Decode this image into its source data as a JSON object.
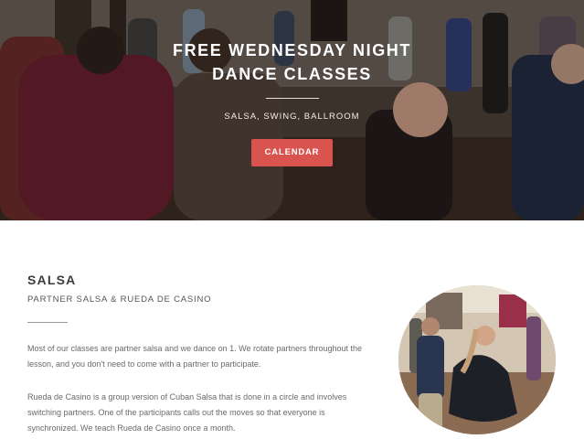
{
  "hero": {
    "title": "FREE WEDNESDAY NIGHT\nDANCE CLASSES",
    "subtitle": "SALSA, SWING, BALLROOM",
    "button_label": "CALENDAR"
  },
  "section": {
    "title": "SALSA",
    "subtitle": "PARTNER SALSA & RUEDA DE CASINO",
    "paragraphs": [
      "Most of our classes are partner salsa and we dance on 1. We rotate partners throughout the lesson, and you don't need to come with a partner to participate.",
      "Rueda de Casino is a group version of Cuban Salsa that is done in a circle and involves switching partners. One of the participants calls out the moves so that everyone is synchronized. We teach Rueda de Casino once a month."
    ]
  },
  "colors": {
    "accent": "#d9534f",
    "heading": "#3c3c3c",
    "body_text": "#6a6a6a"
  }
}
